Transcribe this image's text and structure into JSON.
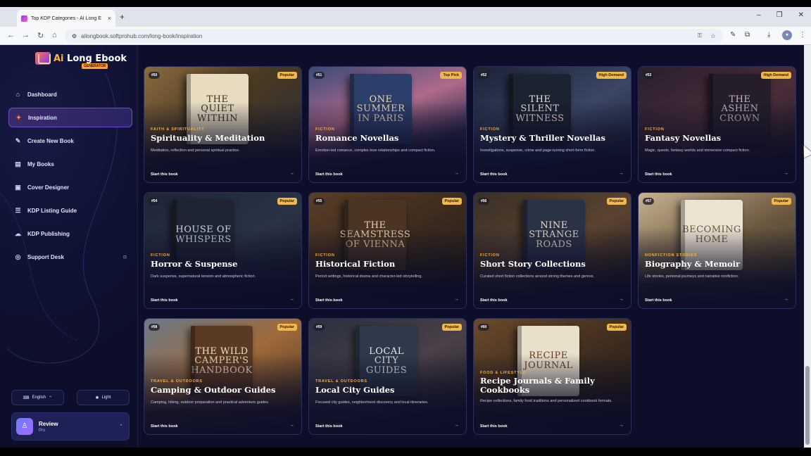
{
  "browser": {
    "tab_title": "Top KDP Categories - AI Long E",
    "tab_close": "×",
    "new_tab": "+",
    "url": "ailongbook.softprohub.com/long-book/inspiration",
    "window_controls": [
      "–",
      "❐",
      "✕"
    ],
    "profile_initial": "●"
  },
  "brand": {
    "name_ai": "Ai",
    "name_rest": " Long Ebook",
    "badge": "GENERATOR"
  },
  "sidebar": {
    "items": [
      {
        "label": "Dashboard",
        "icon": "home-icon",
        "glyph": "⌂",
        "active": false
      },
      {
        "label": "Inspiration",
        "icon": "lightbulb-icon",
        "glyph": "✦",
        "active": true
      },
      {
        "label": "Create New Book",
        "icon": "feather-icon",
        "glyph": "✎",
        "active": false
      },
      {
        "label": "My Books",
        "icon": "books-icon",
        "glyph": "▤",
        "active": false
      },
      {
        "label": "Cover Designer",
        "icon": "image-icon",
        "glyph": "▣",
        "active": false
      },
      {
        "label": "KDP Listing Guide",
        "icon": "list-icon",
        "glyph": "☰",
        "active": false
      },
      {
        "label": "KDP Publishing",
        "icon": "cloud-upload-icon",
        "glyph": "☁",
        "active": false
      },
      {
        "label": "Support Desk",
        "icon": "support-icon",
        "glyph": "◎",
        "active": false,
        "badge": "⊡"
      }
    ],
    "language": "English",
    "language_chevron": "⌃",
    "theme": "Light",
    "user": {
      "name": "Review",
      "plan": "Pro",
      "avatar": "♙",
      "chevron": "⌃"
    }
  },
  "cards": [
    {
      "num": "#50",
      "tag": "Popular",
      "book": "THE QUIET WITHIN",
      "category": "FAITH & SPIRITUALITY",
      "title": "Spirituality & Meditation",
      "desc": "Meditation, reflection and personal spiritual practice.",
      "cta": "Start this book",
      "arrow": "→"
    },
    {
      "num": "#51",
      "tag": "Top Pick",
      "book": "ONE SUMMER IN PARIS",
      "category": "FICTION",
      "title": "Romance Novellas",
      "desc": "Emotion-led romance, complex love relationships and compact fiction.",
      "cta": "Start this book",
      "arrow": "→"
    },
    {
      "num": "#52",
      "tag": "High Demand",
      "book": "THE SILENT WITNESS",
      "category": "FICTION",
      "title": "Mystery & Thriller Novellas",
      "desc": "Investigations, suspense, crime and page-turning short-form fiction.",
      "cta": "Start this book",
      "arrow": "→"
    },
    {
      "num": "#53",
      "tag": "High Demand",
      "book": "THE ASHEN CROWN",
      "category": "FICTION",
      "title": "Fantasy Novellas",
      "desc": "Magic, quests, fantasy worlds and immersive compact fiction.",
      "cta": "Start this book",
      "arrow": "→"
    },
    {
      "num": "#54",
      "tag": "Popular",
      "book": "HOUSE OF WHISPERS",
      "category": "FICTION",
      "title": "Horror & Suspense",
      "desc": "Dark suspense, supernatural tension and atmospheric fiction.",
      "cta": "Start this book",
      "arrow": "→"
    },
    {
      "num": "#55",
      "tag": "Popular",
      "book": "THE SEAMSTRESS OF VIENNA",
      "category": "FICTION",
      "title": "Historical Fiction",
      "desc": "Period settings, historical drama and character-led storytelling.",
      "cta": "Start this book",
      "arrow": "→"
    },
    {
      "num": "#56",
      "tag": "Popular",
      "book": "NINE STRANGE ROADS",
      "category": "FICTION",
      "title": "Short Story Collections",
      "desc": "Curated short fiction collections around strong themes and genres.",
      "cta": "Start this book",
      "arrow": "→"
    },
    {
      "num": "#57",
      "tag": "Popular",
      "book": "BECOMING HOME",
      "category": "NONFICTION STORIES",
      "title": "Biography & Memoir",
      "desc": "Life stories, personal journeys and narrative nonfiction.",
      "cta": "Start this book",
      "arrow": "→"
    },
    {
      "num": "#58",
      "tag": "Popular",
      "book": "THE WILD CAMPER'S HANDBOOK",
      "category": "TRAVEL & OUTDOORS",
      "title": "Camping & Outdoor Guides",
      "desc": "Camping, hiking, outdoor preparation and practical adventure guides.",
      "cta": "Start this book",
      "arrow": "→"
    },
    {
      "num": "#59",
      "tag": "Popular",
      "book": "LOCAL CITY GUIDES",
      "category": "TRAVEL & OUTDOORS",
      "title": "Local City Guides",
      "desc": "Focused city guides, neighborhood discovery and local itineraries.",
      "cta": "Start this book",
      "arrow": "→"
    },
    {
      "num": "#60",
      "tag": "Popular",
      "book": "RECIPE JOURNAL",
      "category": "FOOD & LIFESTYLE",
      "title": "Recipe Journals & Family Cookbooks",
      "desc": "Recipe collections, family food traditions and personalized cookbook formats.",
      "cta": "Start this book",
      "arrow": "→"
    }
  ],
  "colors": {
    "accent": "#ffb02e",
    "tag_bg": "#f0b84a",
    "bg": "#0d0f2a"
  }
}
